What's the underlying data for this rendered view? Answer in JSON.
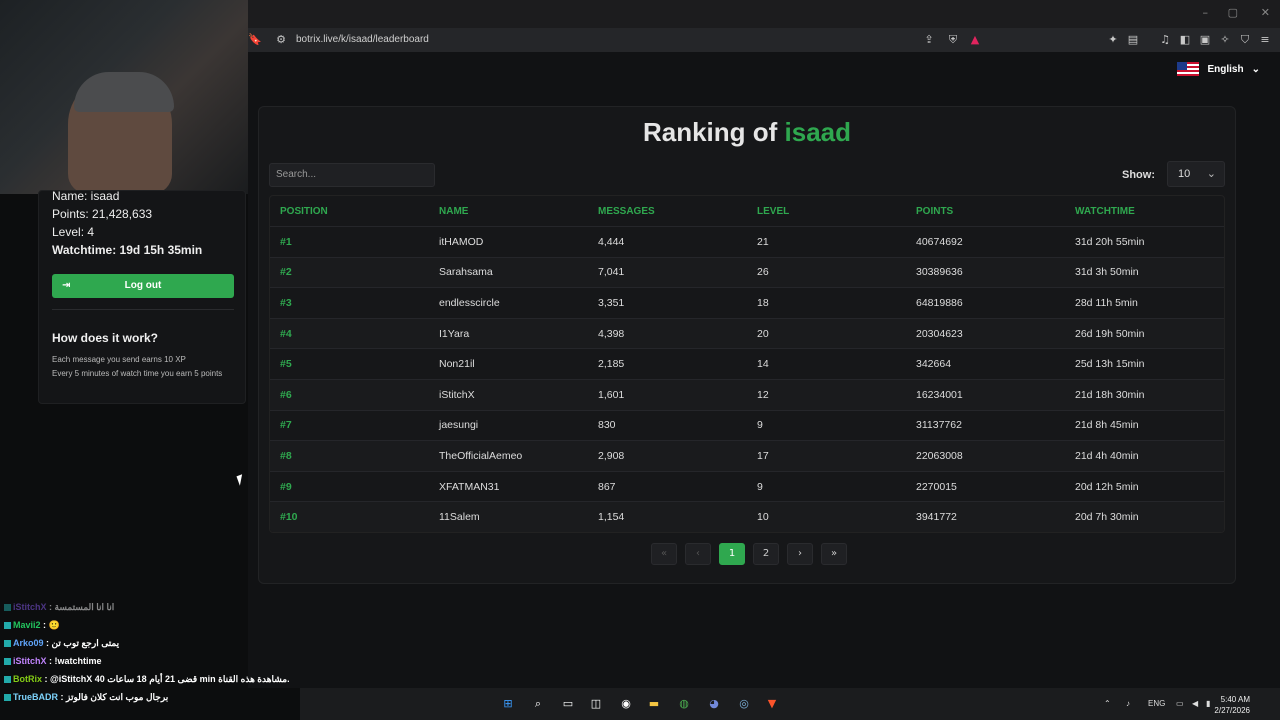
{
  "browser": {
    "url": "botrix.live/k/isaad/leaderboard",
    "window_controls": [
      "–",
      "▢",
      "✕"
    ]
  },
  "language": {
    "label": "English",
    "chevron": "⌄"
  },
  "page": {
    "title_prefix": "Ranking of",
    "title_name": "isaad",
    "search_placeholder": "Search...",
    "show_label": "Show:",
    "show_value": "10"
  },
  "table": {
    "headers": [
      "POSITION",
      "NAME",
      "MESSAGES",
      "LEVEL",
      "POINTS",
      "WATCHTIME"
    ],
    "rows": [
      [
        "#1",
        "itHAMOD",
        "4,444",
        "21",
        "40674692",
        "31d 20h 55min"
      ],
      [
        "#2",
        "Sarahsama",
        "7,041",
        "26",
        "30389636",
        "31d 3h 50min"
      ],
      [
        "#3",
        "endlesscircle",
        "3,351",
        "18",
        "64819886",
        "28d 11h 5min"
      ],
      [
        "#4",
        "I1Yara",
        "4,398",
        "20",
        "20304623",
        "26d 19h 50min"
      ],
      [
        "#5",
        "Non21il",
        "2,185",
        "14",
        "342664",
        "25d 13h 15min"
      ],
      [
        "#6",
        "iStitchX",
        "1,601",
        "12",
        "16234001",
        "21d 18h 30min"
      ],
      [
        "#7",
        "jaesungi",
        "830",
        "9",
        "31137762",
        "21d 8h 45min"
      ],
      [
        "#8",
        "TheOfficialAemeo",
        "2,908",
        "17",
        "22063008",
        "21d 4h 40min"
      ],
      [
        "#9",
        "XFATMAN31",
        "867",
        "9",
        "2270015",
        "20d 12h 5min"
      ],
      [
        "#10",
        "11Salem",
        "1,154",
        "10",
        "3941772",
        "20d 7h 30min"
      ]
    ]
  },
  "pagination": {
    "first": "«",
    "prev": "‹",
    "pages": [
      "1",
      "2"
    ],
    "next": "›",
    "last": "»",
    "active_page": "1"
  },
  "user_panel": {
    "name": "Name: isaad",
    "points": "Points: 21,428,633",
    "level": "Level: 4",
    "watchtime": "Watchtime: 19d 15h 35min",
    "logout_label": "Log out",
    "how_title": "How does it work?",
    "how_line1": "Each message you send earns 10 XP",
    "how_line2": "Every 5 minutes of watch time you earn 5 points"
  },
  "chat": [
    {
      "user": "iStitchX",
      "text": "انا انا المستمسة"
    },
    {
      "user": "Mavii2",
      "text": "🙂"
    },
    {
      "user": "Arko09",
      "text": "يمتى ارجع توب تن"
    },
    {
      "user": "iStitchX",
      "text": "!watchtime"
    },
    {
      "user": "BotRix",
      "text": "@iStitchX قضى 21 أيام 18 ساعات 40 min مشاهدة هذه القناة."
    },
    {
      "user": "TrueBADR",
      "text": "برجال موب انت كلان فالوتز"
    }
  ],
  "taskbar": {
    "lang": "ENG",
    "time": "5:40 AM",
    "date": "2/27/2026"
  },
  "colors": {
    "accent": "#2fa84f",
    "background": "#111214",
    "card": "#161719"
  }
}
